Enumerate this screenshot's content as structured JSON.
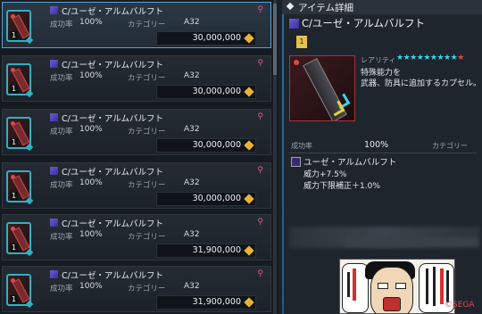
{
  "list": {
    "rows": [
      {
        "qty": "1",
        "name": "C/ユーゼ・アルムバルフト",
        "success_label": "成功率",
        "success": "100%",
        "category_label": "カテゴリー",
        "category": "A32",
        "price": "30,000,000",
        "selected": true
      },
      {
        "qty": "1",
        "name": "C/ユーゼ・アルムバルフト",
        "success_label": "成功率",
        "success": "100%",
        "category_label": "カテゴリー",
        "category": "A32",
        "price": "30,000,000",
        "selected": false
      },
      {
        "qty": "1",
        "name": "C/ユーゼ・アルムバルフト",
        "success_label": "成功率",
        "success": "100%",
        "category_label": "カテゴリー",
        "category": "A32",
        "price": "30,000,000",
        "selected": false
      },
      {
        "qty": "1",
        "name": "C/ユーゼ・アルムバルフト",
        "success_label": "成功率",
        "success": "100%",
        "category_label": "カテゴリー",
        "category": "A32",
        "price": "30,000,000",
        "selected": false
      },
      {
        "qty": "1",
        "name": "C/ユーゼ・アルムバルフト",
        "success_label": "成功率",
        "success": "100%",
        "category_label": "カテゴリー",
        "category": "A32",
        "price": "31,900,000",
        "selected": false
      },
      {
        "qty": "1",
        "name": "C/ユーゼ・アルムバルフト",
        "success_label": "成功率",
        "success": "100%",
        "category_label": "カテゴリー",
        "category": "A32",
        "price": "31,900,000",
        "selected": false
      }
    ],
    "pin_icon": "pin-icon",
    "currency_icon": "meseta-icon"
  },
  "detail": {
    "title": "アイテム詳細",
    "name": "C/ユーゼ・アルムバルフト",
    "qty": "1",
    "rarity_label": "レアリティ",
    "rarity_stars": 9,
    "rarity_red_stars": 1,
    "desc_line1": "特殊能力を",
    "desc_line2": "武器、防具に追加するカプセル。",
    "success_label": "成功率",
    "success": "100%",
    "category_label": "カテゴリー",
    "ability_name": "ユーゼ・アルムバルフト",
    "effect1": "威力+7.5%",
    "effect2": "威力下限補正＋1.0%"
  },
  "footer": {
    "copyright": "©SEGA"
  },
  "colors": {
    "accent": "#4fa3e0",
    "star": "#3fd1e6",
    "meseta": "#e8b437"
  }
}
